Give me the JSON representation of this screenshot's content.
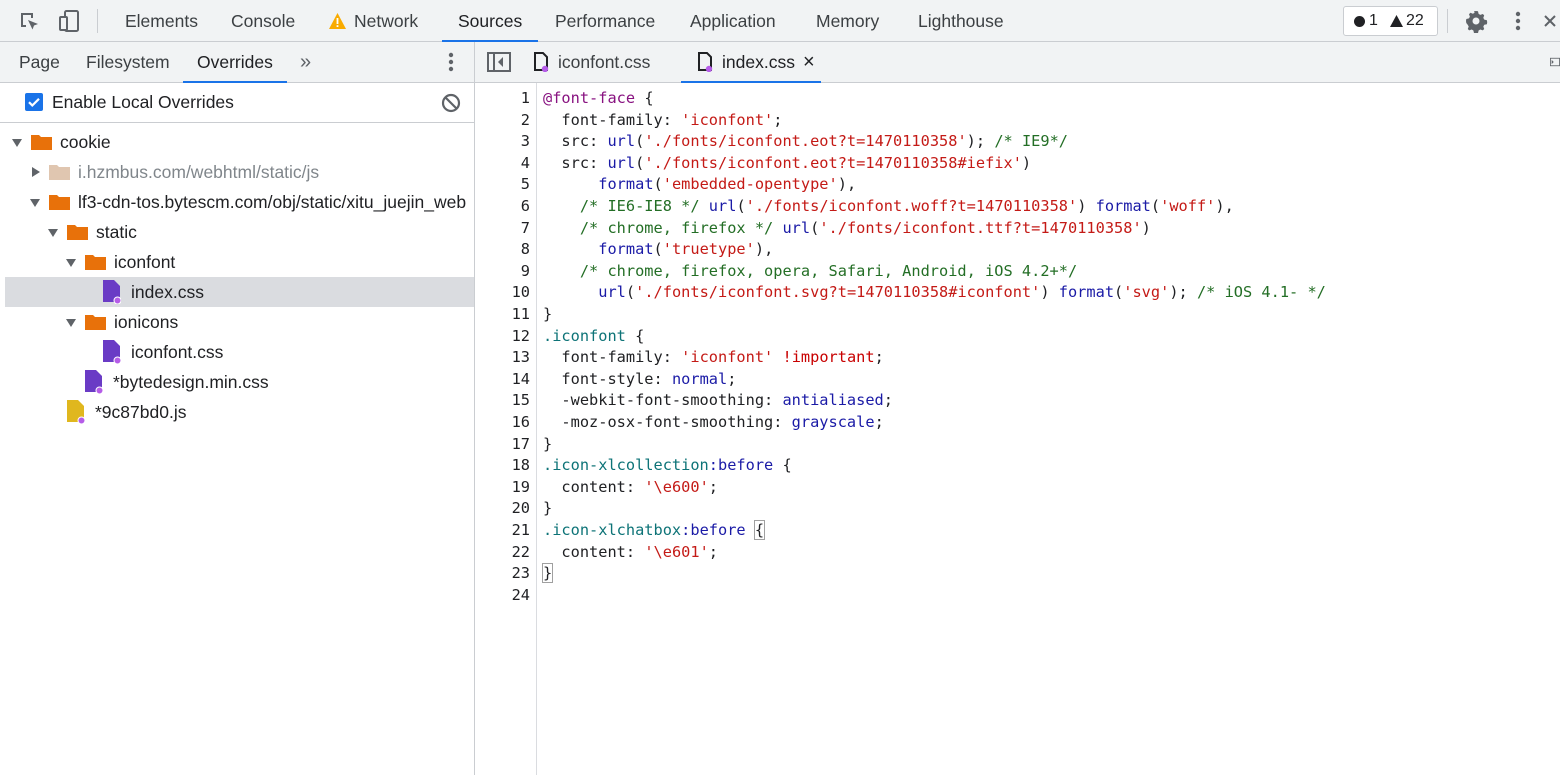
{
  "toolbar": {
    "tabs": [
      "Elements",
      "Console",
      "Network",
      "Sources",
      "Performance",
      "Application",
      "Memory",
      "Lighthouse"
    ],
    "active_tab": "Sources",
    "errors_count": "1",
    "warnings_count": "22"
  },
  "navigator": {
    "tabs": [
      "Page",
      "Filesystem",
      "Overrides"
    ],
    "active_tab": "Overrides",
    "more_tabs": "»",
    "enable_overrides_label": "Enable Local Overrides",
    "enable_overrides_checked": true
  },
  "tree": [
    {
      "label": "cookie",
      "type": "folder",
      "depth": 0,
      "expanded": true
    },
    {
      "label": "i.hzmbus.com/webhtml/static/js",
      "type": "folder-muted",
      "depth": 1,
      "expanded": false
    },
    {
      "label": "lf3-cdn-tos.bytescm.com/obj/static/xitu_juejin_web",
      "type": "folder",
      "depth": 1,
      "expanded": true
    },
    {
      "label": "static",
      "type": "folder",
      "depth": 2,
      "expanded": true
    },
    {
      "label": "iconfont",
      "type": "folder",
      "depth": 3,
      "expanded": true
    },
    {
      "label": "index.css",
      "type": "css-file",
      "depth": 4,
      "selected": true
    },
    {
      "label": "ionicons",
      "type": "folder",
      "depth": 3,
      "expanded": true
    },
    {
      "label": "iconfont.css",
      "type": "css-file",
      "depth": 4
    },
    {
      "label": "*bytedesign.min.css",
      "type": "css-file",
      "depth": 3
    },
    {
      "label": "*9c87bd0.js",
      "type": "js-file",
      "depth": 2
    }
  ],
  "editor": {
    "tabs": [
      {
        "label": "iconfont.css",
        "active": false
      },
      {
        "label": "index.css",
        "active": true,
        "close": "×"
      }
    ],
    "lines": [
      "@font-face {",
      "  font-family: 'iconfont';",
      "  src: url('./fonts/iconfont.eot?t=1470110358'); /* IE9*/",
      "  src: url('./fonts/iconfont.eot?t=1470110358#iefix')",
      "      format('embedded-opentype'),",
      "    /* IE6-IE8 */ url('./fonts/iconfont.woff?t=1470110358') format('woff'),",
      "    /* chrome, firefox */ url('./fonts/iconfont.ttf?t=1470110358')",
      "      format('truetype'),",
      "    /* chrome, firefox, opera, Safari, Android, iOS 4.2+*/",
      "      url('./fonts/iconfont.svg?t=1470110358#iconfont') format('svg'); /* iOS 4.1- */",
      "}",
      ".iconfont {",
      "  font-family: 'iconfont' !important;",
      "  font-style: normal;",
      "  -webkit-font-smoothing: antialiased;",
      "  -moz-osx-font-smoothing: grayscale;",
      "}",
      ".icon-xlcollection:before {",
      "  content: '\\e600';",
      "}",
      ".icon-xlchatbox:before {",
      "  content: '\\e601';",
      "}",
      ""
    ]
  },
  "colors": {
    "accent": "#1a73e8",
    "folder": "#e8710a",
    "css_file": "#6a3bc5",
    "js_file": "#e0b71e",
    "override_dot": "#b55ce8"
  }
}
